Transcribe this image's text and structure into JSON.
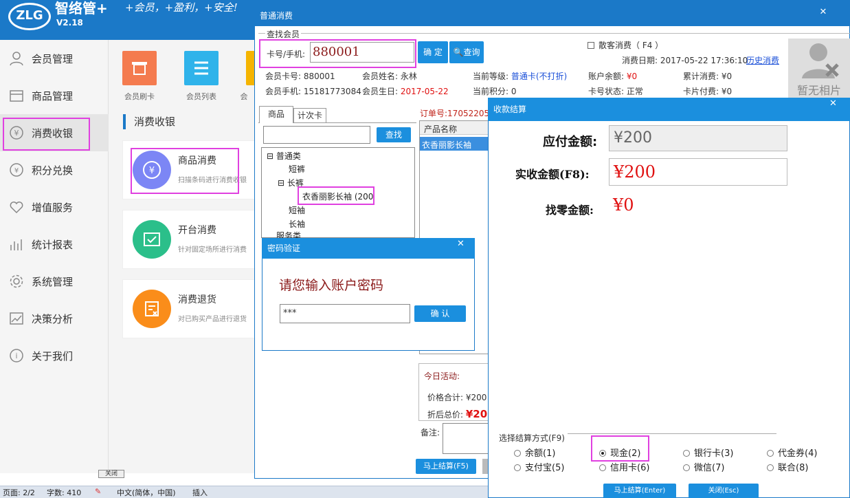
{
  "header": {
    "logo_text": "ZLG",
    "app_name": "智络管+",
    "version": "V2.18",
    "slogan": "+会员，+盈利，+安全!"
  },
  "sidebar": {
    "items": [
      {
        "label": "会员管理",
        "icon": "user-icon"
      },
      {
        "label": "商品管理",
        "icon": "box-icon"
      },
      {
        "label": "消费收银",
        "icon": "yen-icon",
        "active": true
      },
      {
        "label": "积分兑换",
        "icon": "coin-icon"
      },
      {
        "label": "增值服务",
        "icon": "heart-icon"
      },
      {
        "label": "统计报表",
        "icon": "chart-icon"
      },
      {
        "label": "系统管理",
        "icon": "gear-icon"
      },
      {
        "label": "决策分析",
        "icon": "trend-icon"
      },
      {
        "label": "关于我们",
        "icon": "info-icon"
      }
    ]
  },
  "quick": {
    "items": [
      {
        "label": "会员刷卡",
        "color": "#f47b4f"
      },
      {
        "label": "会员列表",
        "color": "#2fb3ea"
      },
      {
        "label": "会",
        "color": "#f5b400"
      }
    ]
  },
  "section": {
    "title": "消费收银",
    "cards": [
      {
        "title": "商品消费",
        "desc": "扫描条码进行消费收银",
        "color": "#7c86f5"
      },
      {
        "title": "开台消费",
        "desc": "针对固定场所进行消费",
        "color": "#2bbf8a"
      },
      {
        "title": "消费退货",
        "desc": "对已购买产品进行退货",
        "color": "#fa8d1a"
      }
    ]
  },
  "status_bar": {
    "page": "页面: 2/2",
    "words": "字数: 410",
    "lang": "中文(简体，中国)",
    "insert": "插入",
    "tray_btn": "关闭"
  },
  "main_window": {
    "title": "普通消费",
    "find_group": "查找会员",
    "card_label": "卡号/手机:",
    "card_value": "880001",
    "confirm_btn": "确 定",
    "query_btn": "查询",
    "walkin": "散客消费（ F4 ）",
    "date_label": "消费日期: 2017-05-22 17:36:10",
    "history_link": "历史消费",
    "member_card": "会员卡号: 880001",
    "member_name": "会员姓名: 永林",
    "member_level_label": "当前等级:",
    "member_level": "普通卡(不打折)",
    "balance_label": "账户余额:",
    "balance": "¥0",
    "total_spend": "累计消费: ¥0",
    "member_phone": "会员手机: 15181773084",
    "birthday_label": "会员生日:",
    "birthday": "2017-05-22",
    "points": "当前积分: 0",
    "card_status": "卡号状态: 正常",
    "card_fee": "卡片付费: ¥0",
    "no_photo": "暂无相片",
    "tabs": [
      "商品",
      "计次卡"
    ],
    "search_btn": "查找",
    "tree": [
      "普通类",
      "短裤",
      "长裤",
      "衣香丽影长袖 (200",
      "短袖",
      "长袖",
      "服务类"
    ],
    "order_no": "订单号:170522052",
    "col_product": "产品名称",
    "order_item": "衣香丽影长袖",
    "today_activity": "今日活动:",
    "price_total": "价格合计: ¥200",
    "discount_label": "折后总价:",
    "discount_total": "¥20",
    "remark_label": "备注:",
    "settle_btn": "马上结算(F5)"
  },
  "pwd_dialog": {
    "title": "密码验证",
    "prompt": "请您输入账户密码",
    "value": "***",
    "ok_btn": "确 认"
  },
  "pay_dialog": {
    "title": "收款结算",
    "due_label": "应付金额:",
    "due_value": "¥200",
    "recv_label": "实收金额(F8):",
    "recv_value": "¥200",
    "change_label": "找零金额:",
    "change_value": "¥0",
    "method_group": "选择结算方式(F9)",
    "methods": [
      {
        "label": "余额(1)",
        "on": false
      },
      {
        "label": "现金(2)",
        "on": true
      },
      {
        "label": "银行卡(3)",
        "on": false
      },
      {
        "label": "代金券(4)",
        "on": false
      },
      {
        "label": "支付宝(5)",
        "on": false
      },
      {
        "label": "信用卡(6)",
        "on": false
      },
      {
        "label": "微信(7)",
        "on": false
      },
      {
        "label": "联合(8)",
        "on": false
      }
    ],
    "settle_btn": "马上结算(Enter)",
    "close_btn": "关闭(Esc)"
  }
}
